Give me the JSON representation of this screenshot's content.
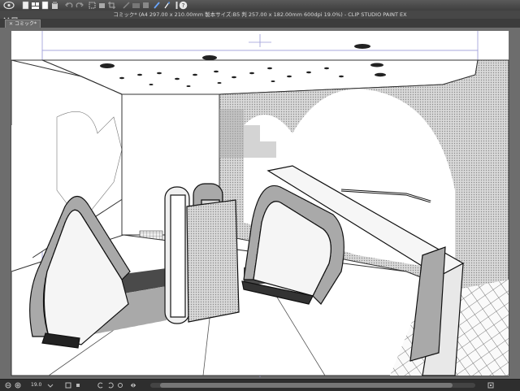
{
  "app": {
    "window_title": "コミック* (A4 297.00 x 210.00mm 製本サイズ:B5 判 257.00 x 182.00mm 600dpi 19.0%) - CLIP STUDIO PAINT EX"
  },
  "document": {
    "tab_label": "コミック*"
  },
  "toolbar": {
    "icons": [
      "app-menu-icon",
      "new-document-icon",
      "open-document-icon",
      "save-icon",
      "undo-icon",
      "redo-icon",
      "transform-icon",
      "clear-icon",
      "fill-icon",
      "layer-settings-icon",
      "color-icon",
      "brush-icon",
      "pen-icon",
      "eyedropper-icon",
      "help-icon"
    ]
  },
  "status": {
    "zoom": "19.0",
    "icons": [
      "zoom-out-icon",
      "zoom-in-icon",
      "fit-page-icon",
      "rotate-left-icon",
      "rotate-right-icon",
      "flip-icon",
      "navigator-icon"
    ]
  },
  "colors": {
    "toolbar_bg": "#4a4a4a",
    "canvas_bg": "#6d6d6d",
    "page": "#ffffff",
    "frame_guide": "#9a9ad8",
    "accent_blue": "#5a8fd8"
  }
}
